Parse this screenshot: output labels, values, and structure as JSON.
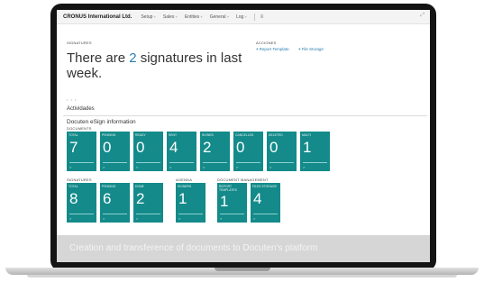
{
  "app": {
    "company": "CRONUS International Ltd.",
    "menu": [
      "Setup",
      "Sales",
      "Entities",
      "General",
      "Log"
    ],
    "hamburger": "≡",
    "expand": "⤢"
  },
  "headline": {
    "label": "SIGNATURES",
    "text_before": "There are ",
    "count": "2",
    "text_after": " signatures in last week."
  },
  "actions": {
    "label": "ACCIONES",
    "report_template": "Report Template",
    "file_storage": "File Storage",
    "plus": "+"
  },
  "pager": "• • •",
  "activities": {
    "title": "Actividades",
    "group_title": "Docuten eSign information"
  },
  "documents": {
    "label": "DOCUMENTS",
    "tiles": [
      {
        "label": "TOTAL",
        "value": "7"
      },
      {
        "label": "PENDING",
        "value": "0"
      },
      {
        "label": "READY",
        "value": "0"
      },
      {
        "label": "SENT",
        "value": "4"
      },
      {
        "label": "SIGNED",
        "value": "2"
      },
      {
        "label": "CANCELLED",
        "value": "0"
      },
      {
        "label": "DELETED",
        "value": "0"
      },
      {
        "label": "MULTI",
        "value": "1"
      }
    ]
  },
  "signatures": {
    "label": "SIGNATURES",
    "tiles": [
      {
        "label": "TOTAL",
        "value": "8"
      },
      {
        "label": "PENDING",
        "value": "6"
      },
      {
        "label": "DONE",
        "value": "2"
      }
    ]
  },
  "agenda": {
    "label": "AGENDA",
    "tiles": [
      {
        "label": "SIGNERS",
        "value": "1"
      }
    ]
  },
  "document_management": {
    "label": "DOCUMENT MANAGEMENT",
    "tiles": [
      {
        "label": "REPORT TEMPLATES",
        "value": "1"
      },
      {
        "label": "FILES STORAGE",
        "value": "4"
      }
    ]
  },
  "tile_arrow": ">",
  "footer": {
    "text": "Creation and transference of documents to Docuten's platform"
  },
  "colors": {
    "tile": "#148a8a",
    "accent": "#2b7fb0"
  }
}
